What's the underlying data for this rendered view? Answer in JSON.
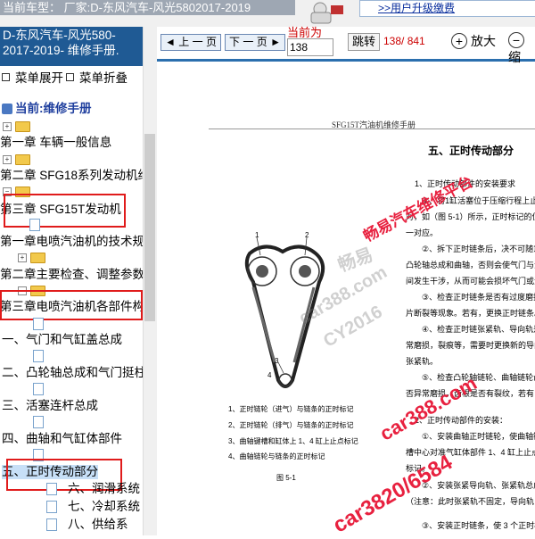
{
  "header": {
    "vehicle_label": "当前车型： 厂家:D-东风汽车-风光5802017-2019",
    "upgrade_link": ">>用户升级缴费"
  },
  "sidebar": {
    "title_line1": "D-东风汽车-风光580-",
    "title_line2": "2017-2019- 维修手册.",
    "expand_label": "菜单展开",
    "collapse_label": "菜单折叠",
    "current_label": "当前:维修手册",
    "items": [
      "第一章 车辆一般信息",
      "第二章 SFG18系列发动机维",
      "第三章 SFG15T发动机",
      "第一章电喷汽油机的技术规",
      "第二章主要检查、调整参数",
      "第三章电喷汽油机各部件构",
      "一、气门和气缸盖总成",
      "二、凸轮轴总成和气门挺柱",
      "三、活塞连杆总成",
      "四、曲轴和气缸体部件",
      "五、正时传动部分",
      "六、润滑系统",
      "七、冷却系统",
      "八、供给系"
    ]
  },
  "toolbar": {
    "prev_label": "上 一 页",
    "next_label": "下 一 页",
    "current_page_label": "当前为",
    "page_input_value": "138",
    "jump_label": "跳转",
    "page_count": "138/ 841",
    "zoom_in_label": "放大",
    "zoom_out_label": "缩"
  },
  "document": {
    "page_header": "SFG15T汽油机维修手册",
    "section_title": "五、正时传动部分",
    "paragraphs": [
      "1、正时传动部件的安装要求",
      "①、将1缸活塞位于压缩行程上止",
      "对，如（图 5-1）所示，正时标记的位",
      "一对应。",
      "②、拆下正时链条后，决不可随意",
      "凸轮轴总成和曲轴，否则会使气门与活",
      "间发生干涉，从而可能会损坏气门或活",
      "③、检查正时链条是否有过度磨损",
      "片断裂等现象。若有，更换正时链条。",
      "④、检查正时链张紧轨、导向轨是否",
      "常磨损，裂痕等，需要时更换新的导向",
      "张紧轨。",
      "⑤、检查凸轮轴链轮、曲轴链轮齿",
      "否异常磨损，齿根是否有裂纹，若有，",
      "2、正时传动部件的安装：",
      "①、安装曲轴正时链轮，使曲轴链",
      "槽中心对准气缸体部件 1、4 缸上止点",
      "标记。",
      "②、安装张紧导向轨、张紧轨总成",
      "（注意：此时张紧轨不固定，导向轨",
      "③、安装正时链条，使 3 个正时标"
    ],
    "legend": [
      "1、正时链轮（进气）与链条的正时标记",
      "2、正时链轮（排气）与链条的正时标记",
      "3、曲轴键槽和缸体上 1、4 缸上止点标记",
      "4、曲轴链轮与链条的正时标记"
    ],
    "figure_caption": "图 5-1",
    "figure_numbers": [
      "1",
      "2",
      "3",
      "4"
    ]
  },
  "watermarks": {
    "red_top": "畅易汽车维修平台",
    "gray1": "畅易",
    "gray2": "car388.com",
    "gray3": "CY2016",
    "red_bottom1": "car388.com",
    "red_bottom2": "car3820/6584"
  },
  "colors": {
    "title_bar": "#1f5a94",
    "toolbar_rule": "#2b6fae",
    "red_highlight": "#e01b1b",
    "watermark_red": "#e8213f"
  }
}
